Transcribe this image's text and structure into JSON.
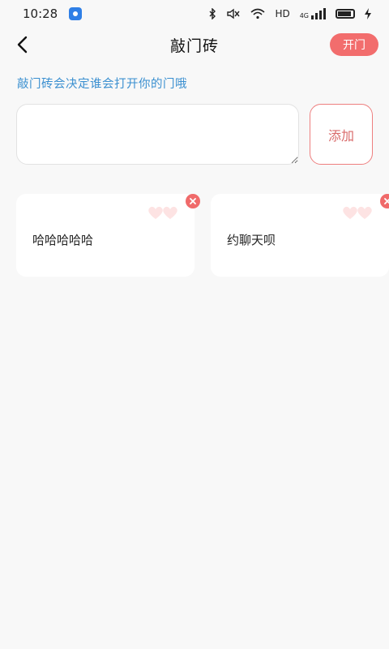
{
  "status_bar": {
    "time": "10:28",
    "network": "HD",
    "signal_label": "4G"
  },
  "nav": {
    "title": "敲门砖",
    "open_button": "开门"
  },
  "hint": "敲门砖会决定谁会打开你的门哦",
  "input": {
    "value": "",
    "placeholder": ""
  },
  "add_button": "添加",
  "cards": [
    {
      "text": "哈哈哈哈哈"
    },
    {
      "text": "约聊天呗"
    }
  ],
  "colors": {
    "accent": "#f26d6d",
    "hint": "#3a8fd0",
    "heart": "#fde3e3"
  },
  "icons": {
    "back": "back-arrow-icon",
    "remove": "close-icon",
    "decor": "heart-icon"
  }
}
